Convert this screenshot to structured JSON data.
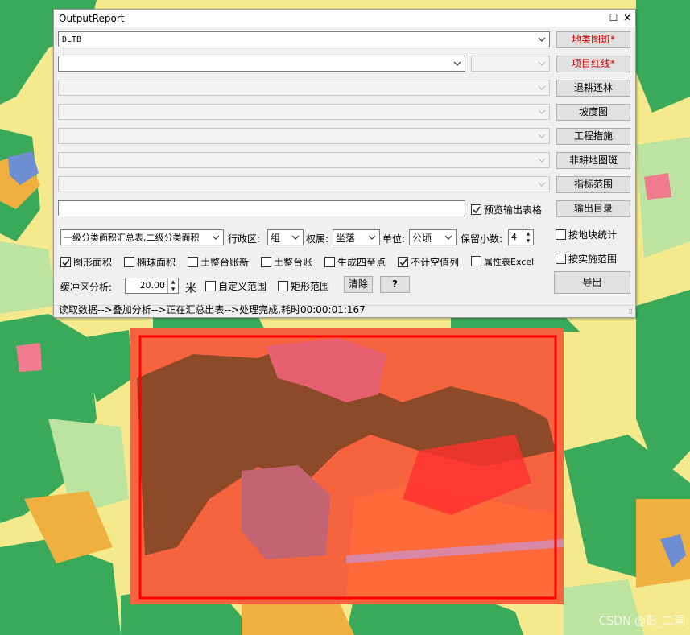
{
  "window": {
    "title": "OutputReport"
  },
  "rows": {
    "landuse_combo_value": "DLTB",
    "landuse_button": "地类图斑*",
    "redline_button": "项目红线*",
    "return_farmland_button": "退耕还林",
    "slope_button": "坡度图",
    "engineering_button": "工程措施",
    "nonfarm_button": "非耕地图斑",
    "indicator_button": "指标范围",
    "output_dir_button": "输出目录",
    "preview_label": "预览输出表格"
  },
  "options": {
    "report_type": "一级分类面积汇总表,二级分类面积",
    "admin_label": "行政区:",
    "admin_value": "组",
    "ownership_label": "权属:",
    "ownership_value": "坐落",
    "unit_label": "单位:",
    "unit_value": "公顷",
    "decimals_label": "保留小数:",
    "decimals_value": "4",
    "by_parcel_label": "按地块统计",
    "by_impl_label": "按实施范围",
    "graphic_area_label": "图形面积",
    "ellipsoid_area_label": "椭球面积",
    "land_ledger_new_label": "土整台账新",
    "land_ledger_label": "土整台账",
    "four_corners_label": "生成四至点",
    "ignore_null_label": "不计空值列",
    "attr_excel_label": "属性表Excel",
    "buffer_label": "缓冲区分析:",
    "buffer_value": "20.00",
    "buffer_unit": "米",
    "custom_range_label": "自定义范围",
    "rect_range_label": "矩形范围",
    "clear_button": "清除",
    "help_button": "?",
    "export_button": "导出"
  },
  "checks": {
    "preview": true,
    "by_parcel": false,
    "by_impl": false,
    "graphic_area": true,
    "ellipsoid_area": false,
    "land_ledger_new": false,
    "land_ledger": false,
    "four_corners": false,
    "ignore_null": true,
    "attr_excel": false,
    "custom_range": false,
    "rect_range": false
  },
  "status": {
    "text": "读取数据-->叠加分析-->正在汇总出表-->处理完成,耗时00:00:01:167"
  },
  "watermark": "CSDN @彭_二洞",
  "colors": {
    "map_yellow": "#f4e98c",
    "map_green": "#3aaa5a",
    "map_lightgreen": "#bde3a0",
    "map_orange": "#f0b040",
    "overlay_red": "#ff4a2a",
    "brown": "#8c4a28",
    "border_red": "#ff0000",
    "button_red_text": "#d40000"
  }
}
